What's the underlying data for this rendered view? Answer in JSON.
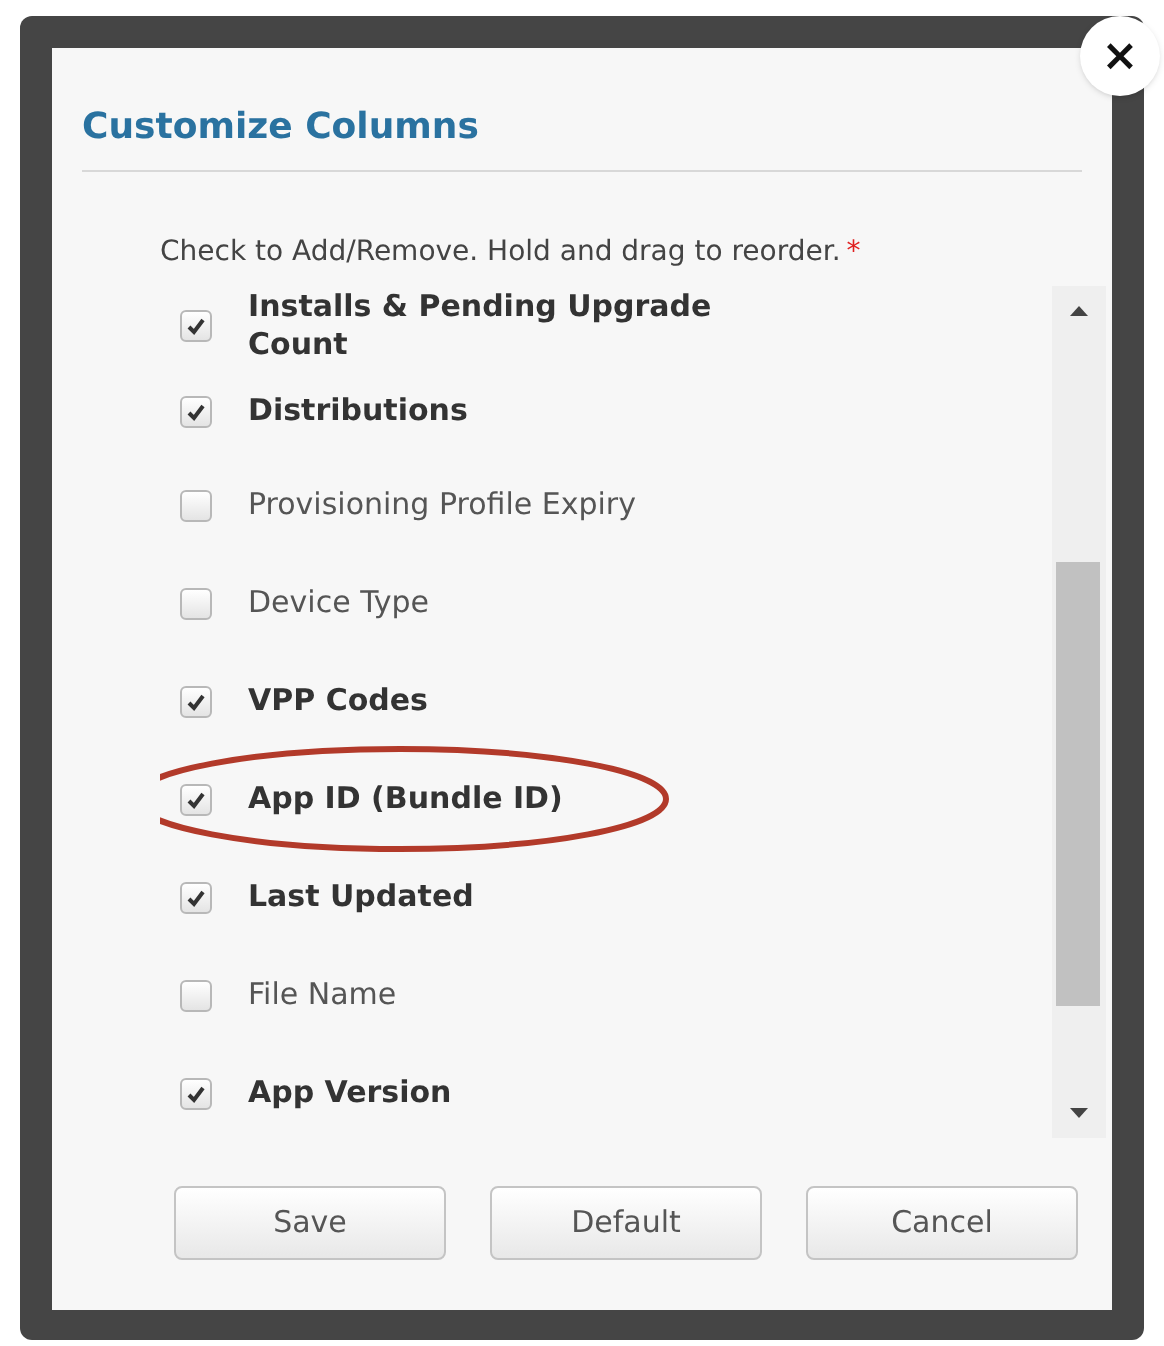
{
  "dialog": {
    "title": "Customize Columns",
    "close": "×",
    "instruction": "Check to Add/Remove. Hold and drag to reorder.",
    "required_mark": "*"
  },
  "columns": [
    {
      "label": "Installs & Pending Upgrade Count",
      "checked": true,
      "highlighted": false
    },
    {
      "label": "Distributions",
      "checked": true,
      "highlighted": false
    },
    {
      "label": "Provisioning Profile Expiry",
      "checked": false,
      "highlighted": false
    },
    {
      "label": "Device Type",
      "checked": false,
      "highlighted": false
    },
    {
      "label": "VPP Codes",
      "checked": true,
      "highlighted": false
    },
    {
      "label": "App ID (Bundle ID)",
      "checked": true,
      "highlighted": true
    },
    {
      "label": "Last Updated",
      "checked": true,
      "highlighted": false
    },
    {
      "label": "File Name",
      "checked": false,
      "highlighted": false
    },
    {
      "label": "App Version",
      "checked": true,
      "highlighted": false
    }
  ],
  "buttons": [
    "Save",
    "Default",
    "Cancel"
  ]
}
